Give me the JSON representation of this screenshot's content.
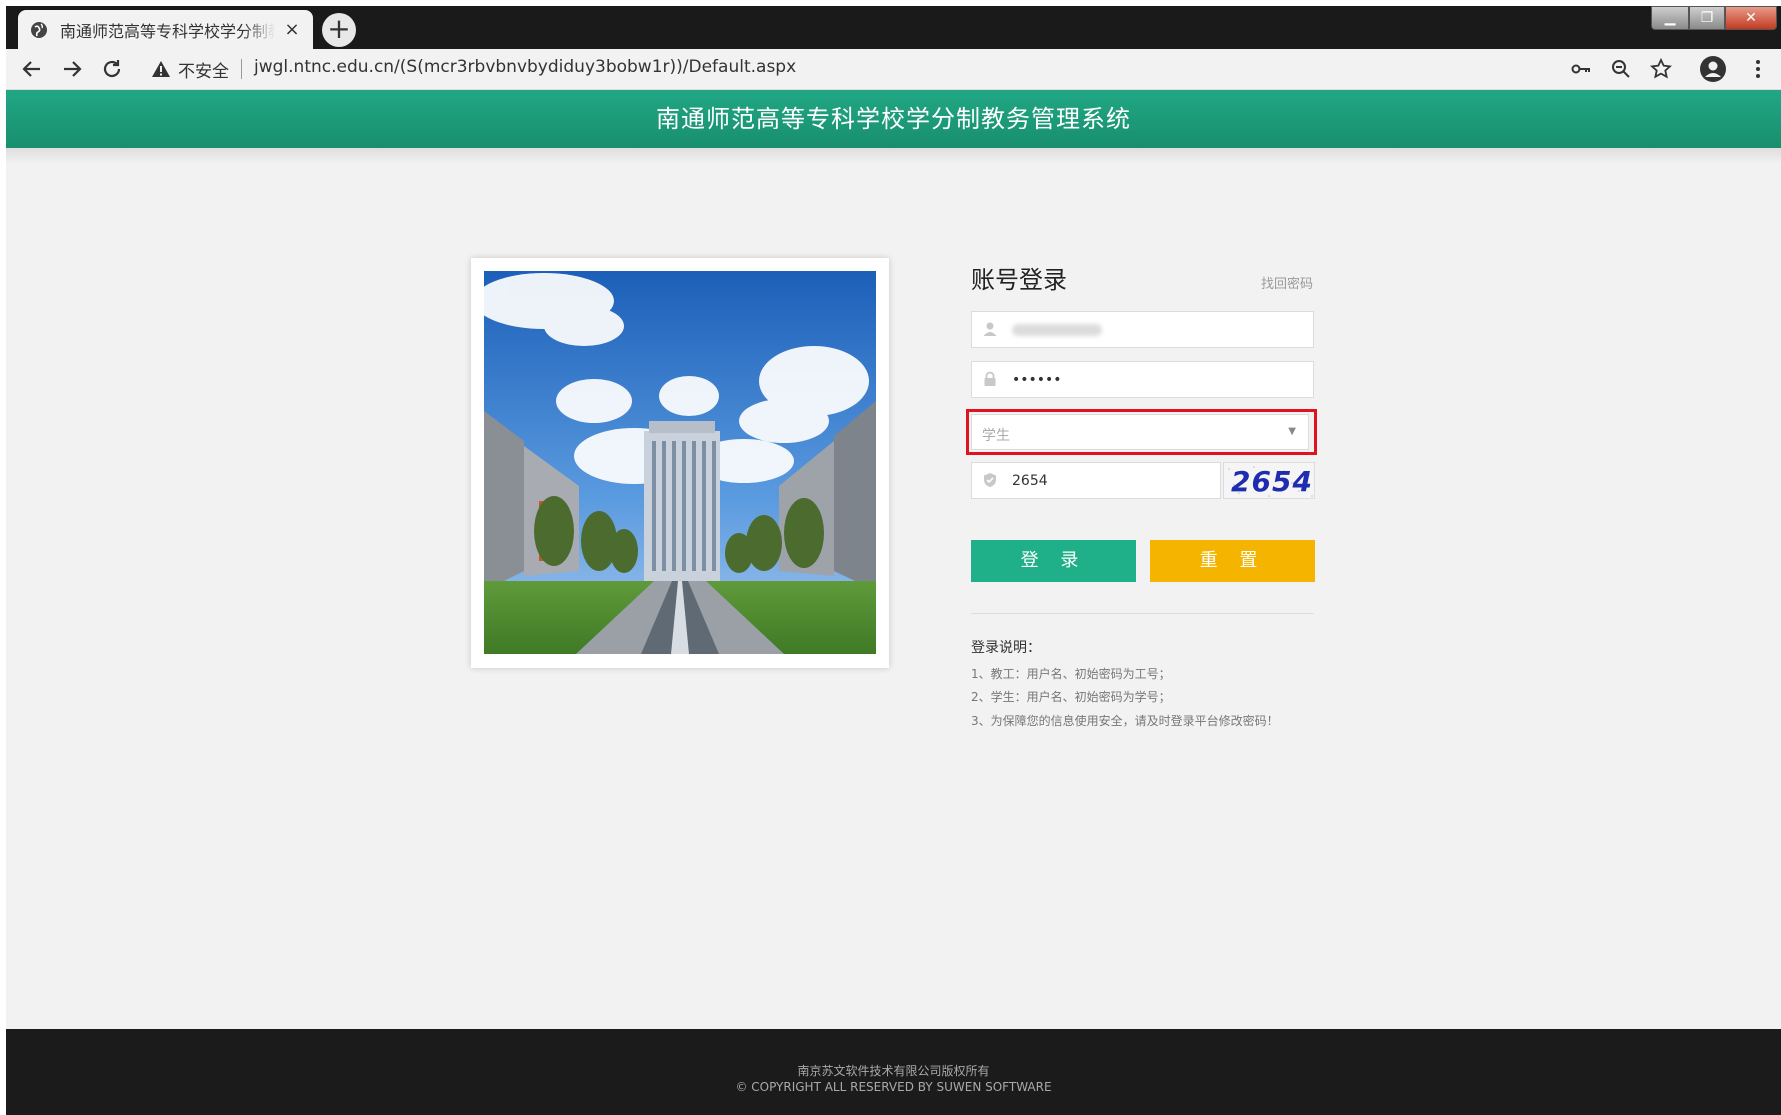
{
  "browser": {
    "tab_title": "南通师范高等专科学校学分制教务管理系统",
    "tab_close": "×",
    "new_tab": "+",
    "address": {
      "security_label": "不安全",
      "url": "jwgl.ntnc.edu.cn/(S(mcr3rbvbnvbydiduy3bobw1r))/Default.aspx"
    }
  },
  "header": {
    "title": "南通师范高等专科学校学分制教务管理系统"
  },
  "login": {
    "title": "账号登录",
    "find_password": "找回密码",
    "password_value": "••••••",
    "role_value": "学生",
    "captcha_input": "2654",
    "captcha_image_text": "2654",
    "login_button": "登 录",
    "reset_button": "重 置"
  },
  "notes": {
    "title": "登录说明：",
    "items": [
      "1、教工：用户名、初始密码为工号；",
      "2、学生：用户名、初始密码为学号；",
      "3、为保障您的信息使用安全，请及时登录平台修改密码！"
    ]
  },
  "footer": {
    "line1": "南京苏文软件技术有限公司版权所有",
    "line2": "© COPYRIGHT ALL RESERVED BY SUWEN SOFTWARE"
  },
  "colors": {
    "header_green": "#1a9c7a",
    "login_button": "#1fb089",
    "reset_button": "#f4b400",
    "highlight_red": "#e0141e"
  },
  "icons": [
    "globe-icon",
    "back-arrow-icon",
    "forward-arrow-icon",
    "reload-icon",
    "warning-icon",
    "key-icon",
    "zoom-icon",
    "star-icon",
    "profile-icon",
    "menu-icon",
    "user-icon",
    "lock-icon",
    "shield-icon"
  ]
}
